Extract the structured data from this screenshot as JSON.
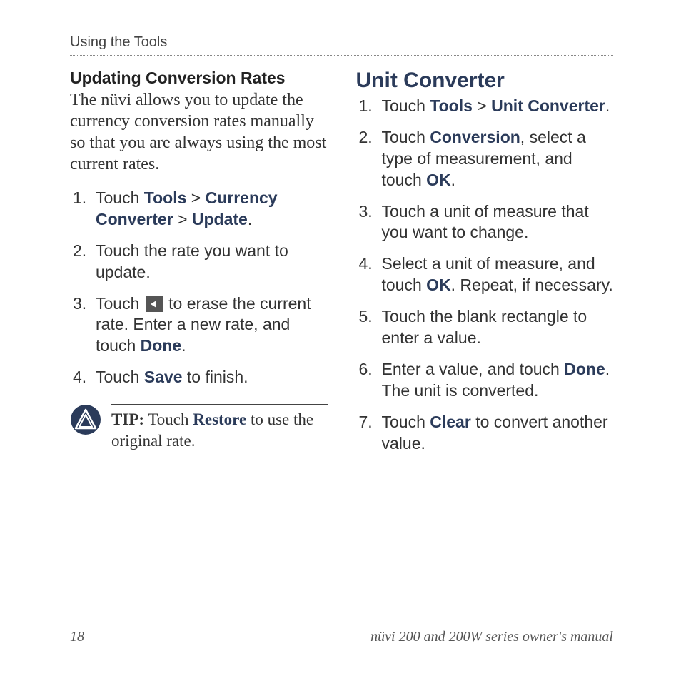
{
  "header": "Using the Tools",
  "left": {
    "heading": "Updating Conversion Rates",
    "intro": "The nüvi allows you to update the currency conversion rates manually so that you are always using the most current rates.",
    "step1": {
      "touch": "Touch ",
      "tools": "Tools",
      "gt1": " > ",
      "cc": "Currency Converter",
      "gt2": " > ",
      "update": "Update",
      "dot": "."
    },
    "step2": "Touch the rate you want to update.",
    "step3": {
      "pre": "Touch ",
      "post": " to erase the current rate. Enter a new rate, and touch ",
      "done": "Done",
      "dot": "."
    },
    "step4": {
      "pre": "Touch ",
      "save": "Save",
      "post": " to finish."
    },
    "tip": {
      "label": "TIP:",
      "pre": " Touch ",
      "restore": "Restore",
      "post": " to use the original rate."
    }
  },
  "right": {
    "heading": "Unit Converter",
    "step1": {
      "touch": "Touch ",
      "tools": "Tools",
      "gt": " > ",
      "uc": "Unit Converter",
      "dot": "."
    },
    "step2": {
      "pre": "Touch ",
      "conv": "Conversion",
      "mid": ", select a type of measurement, and touch ",
      "ok": "OK",
      "dot": "."
    },
    "step3": "Touch a unit of measure that you want to change.",
    "step4": {
      "pre": "Select a unit of measure, and touch ",
      "ok": "OK",
      "post": ". Repeat, if necessary."
    },
    "step5": "Touch the blank rectangle to enter a value.",
    "step6": {
      "pre": "Enter a value, and touch ",
      "done": "Done",
      "post": ". The unit is converted."
    },
    "step7": {
      "pre": "Touch ",
      "clear": "Clear",
      "post": " to convert another value."
    }
  },
  "footer": {
    "page": "18",
    "title": "nüvi 200 and 200W series owner's manual"
  }
}
